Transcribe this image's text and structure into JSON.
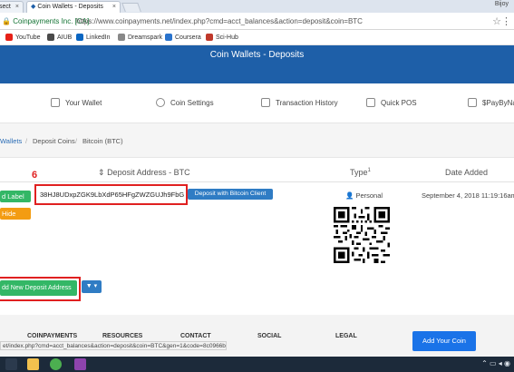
{
  "browser": {
    "tabs": [
      {
        "label": "sect",
        "close": "×"
      },
      {
        "label": "Coin Wallets - Deposits",
        "close": "×"
      }
    ],
    "window_user": "Bijoy",
    "secure_label": "Coinpayments Inc. [CA]",
    "url": "https://www.coinpayments.net/index.php?cmd=acct_balances&action=deposit&coin=BTC",
    "bookmarks": [
      {
        "label": "YouTube",
        "color": "#e62117"
      },
      {
        "label": "AIUB",
        "color": "#4a4a4a"
      },
      {
        "label": "LinkedIn",
        "color": "#0a66c2"
      },
      {
        "label": "Dreamspark",
        "color": "#888888"
      },
      {
        "label": "Coursera",
        "color": "#2a73cc"
      },
      {
        "label": "Sci-Hub",
        "color": "#c0392b"
      }
    ],
    "status_url": "et/index.php?cmd=acct_balances&action=deposit&coin=BTC&gen=1&code=8c0966bd"
  },
  "site": {
    "title": "Coin Wallets - Deposits",
    "nav": [
      {
        "label": "Your Wallet",
        "icon": "wallet-icon"
      },
      {
        "label": "Coin Settings",
        "icon": "gear-icon"
      },
      {
        "label": "Transaction History",
        "icon": "history-icon"
      },
      {
        "label": "Quick POS",
        "icon": "pos-icon"
      },
      {
        "label": "$PayByNa",
        "icon": "paybyname-icon"
      }
    ],
    "breadcrumb": [
      "Wallets",
      "/",
      "Deposit Coins",
      "/",
      "Bitcoin (BTC)"
    ]
  },
  "table": {
    "headers": {
      "address": "Deposit Address - BTC",
      "type": "Type",
      "type_sup": "1",
      "date": "Date Added"
    },
    "left_buttons": {
      "label": "d Label",
      "hide": "Hide"
    },
    "annotation_number": "6",
    "row": {
      "address": "38HJ8UDxpZGK9LbXdP65HFgZWZGUJh9FbG",
      "bitcoin_client": "Deposit with Bitcoin Client",
      "type": "Personal",
      "date": "September 4, 2018 11:19:16am"
    },
    "add_button": "dd New Deposit Address",
    "filter_button": "▼ ▾"
  },
  "footer": {
    "columns": [
      "COINPAYMENTS",
      "RESOURCES",
      "CONTACT",
      "SOCIAL",
      "LEGAL"
    ],
    "add_coin": "Add Your Coin"
  },
  "colors": {
    "header_blue": "#1e5fa8",
    "green": "#33b766",
    "blue_button": "#2f7cc4",
    "annotation_red": "#e02020"
  }
}
